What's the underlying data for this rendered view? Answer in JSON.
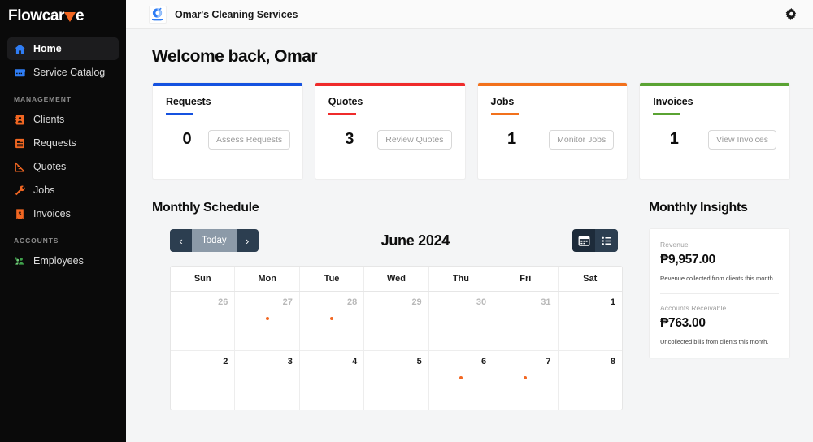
{
  "sidebar": {
    "brand": {
      "pre": "Flowcar",
      "post": "e",
      "icon": "chevron-down-icon"
    },
    "items": [
      {
        "label": "Home",
        "icon": "home-icon",
        "active": true
      },
      {
        "label": "Service Catalog",
        "icon": "storefront-icon",
        "active": false
      }
    ],
    "sections": [
      {
        "label": "MANAGEMENT",
        "items": [
          {
            "label": "Clients",
            "icon": "contact-card-icon"
          },
          {
            "label": "Requests",
            "icon": "request-form-icon"
          },
          {
            "label": "Quotes",
            "icon": "ruler-triangle-icon"
          },
          {
            "label": "Jobs",
            "icon": "wrench-icon"
          },
          {
            "label": "Invoices",
            "icon": "invoice-icon"
          }
        ]
      },
      {
        "label": "ACCOUNTS",
        "items": [
          {
            "label": "Employees",
            "icon": "add-people-icon"
          }
        ]
      }
    ]
  },
  "topbar": {
    "org_name": "Omar's Cleaning Services",
    "org_logo": "cleaning-services-logo",
    "settings_icon": "gear-icon"
  },
  "main": {
    "welcome": "Welcome back, Omar",
    "stats": [
      {
        "title": "Requests",
        "value": "0",
        "button": "Assess Requests",
        "color": "#1552e0"
      },
      {
        "title": "Quotes",
        "value": "3",
        "button": "Review Quotes",
        "color": "#ef2b2b"
      },
      {
        "title": "Jobs",
        "value": "1",
        "button": "Monitor Jobs",
        "color": "#f2711c"
      },
      {
        "title": "Invoices",
        "value": "1",
        "button": "View Invoices",
        "color": "#5aa333"
      }
    ],
    "schedule": {
      "title": "Monthly Schedule",
      "toolbar": {
        "prev": "‹",
        "today": "Today",
        "next": "›",
        "month_title": "June 2024",
        "view_calendar_icon": "calendar-view-icon",
        "view_list_icon": "list-view-icon"
      },
      "weekdays": [
        "Sun",
        "Mon",
        "Tue",
        "Wed",
        "Thu",
        "Fri",
        "Sat"
      ],
      "weeks": [
        [
          {
            "day": "26",
            "muted": true,
            "dot": false
          },
          {
            "day": "27",
            "muted": true,
            "dot": true
          },
          {
            "day": "28",
            "muted": true,
            "dot": true
          },
          {
            "day": "29",
            "muted": true,
            "dot": false
          },
          {
            "day": "30",
            "muted": true,
            "dot": false
          },
          {
            "day": "31",
            "muted": true,
            "dot": false
          },
          {
            "day": "1",
            "muted": false,
            "dot": false
          }
        ],
        [
          {
            "day": "2",
            "muted": false,
            "dot": false
          },
          {
            "day": "3",
            "muted": false,
            "dot": false
          },
          {
            "day": "4",
            "muted": false,
            "dot": false
          },
          {
            "day": "5",
            "muted": false,
            "dot": false
          },
          {
            "day": "6",
            "muted": false,
            "dot": true
          },
          {
            "day": "7",
            "muted": false,
            "dot": true
          },
          {
            "day": "8",
            "muted": false,
            "dot": false
          }
        ]
      ]
    },
    "insights": {
      "title": "Monthly Insights",
      "rows": [
        {
          "label": "Revenue",
          "value": "₱9,957.00",
          "desc": "Revenue collected from clients this month."
        },
        {
          "label": "Accounts Receivable",
          "value": "₱763.00",
          "desc": "Uncollected bills from clients this month."
        }
      ]
    }
  },
  "colors": {
    "accent_orange": "#f26722",
    "sidebar_bg": "#0a0a0a",
    "page_bg": "#f4f5f6",
    "toolbar_navy": "#2c3e50"
  }
}
